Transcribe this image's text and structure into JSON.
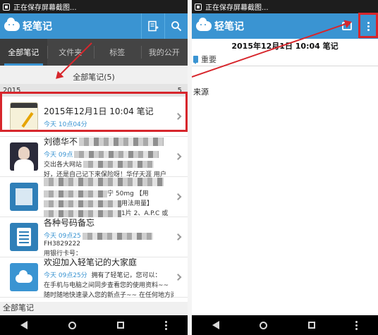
{
  "status": {
    "text": "正在保存屏幕截图..."
  },
  "app": {
    "name": "轻笔记"
  },
  "tabs": [
    {
      "label": "全部笔记"
    },
    {
      "label": "文件夹"
    },
    {
      "label": "标签"
    },
    {
      "label": "我的公开"
    }
  ],
  "list": {
    "section_title": "全部笔记(5)",
    "year": "2015",
    "year_count": "5",
    "notes": [
      {
        "title": "2015年12月1日 10:04 笔记",
        "meta": "今天 10点04分",
        "preview": "",
        "line2": ""
      },
      {
        "title": "刘德华不",
        "meta": "今天 09点",
        "preview": "",
        "line2": "交出各大网站",
        "line3": "好，还是自己记下来保险呀！华仔天涯 用户"
      },
      {
        "title": "",
        "meta": "今天 09点",
        "preview": "宁 50mg 【用",
        "line2": "用法用量】",
        "line3": "1片 2、A.P.C 或"
      },
      {
        "title": "各种号码备忘",
        "meta": "今天 09点25",
        "preview": "",
        "line2": "FH3829222",
        "line3": "用银行卡号："
      },
      {
        "title": "欢迎加入轻笔记的大家庭",
        "meta": "今天 09点25分",
        "preview": "拥有了轻笔记，您可以：",
        "line2": "在手机与电脑之间同步查看您的使用资料~~",
        "line3": "随时随地快速录入您的新点子~~ 在任何地方阅读"
      }
    ],
    "footer_title": "全部笔记"
  },
  "detail": {
    "title": "2015年12月1日 10:04 笔记",
    "tag": "重要",
    "source": "来源"
  },
  "colors": {
    "accent": "#3a94d2",
    "annotation": "#d7262c",
    "tabbar": "#444444"
  }
}
